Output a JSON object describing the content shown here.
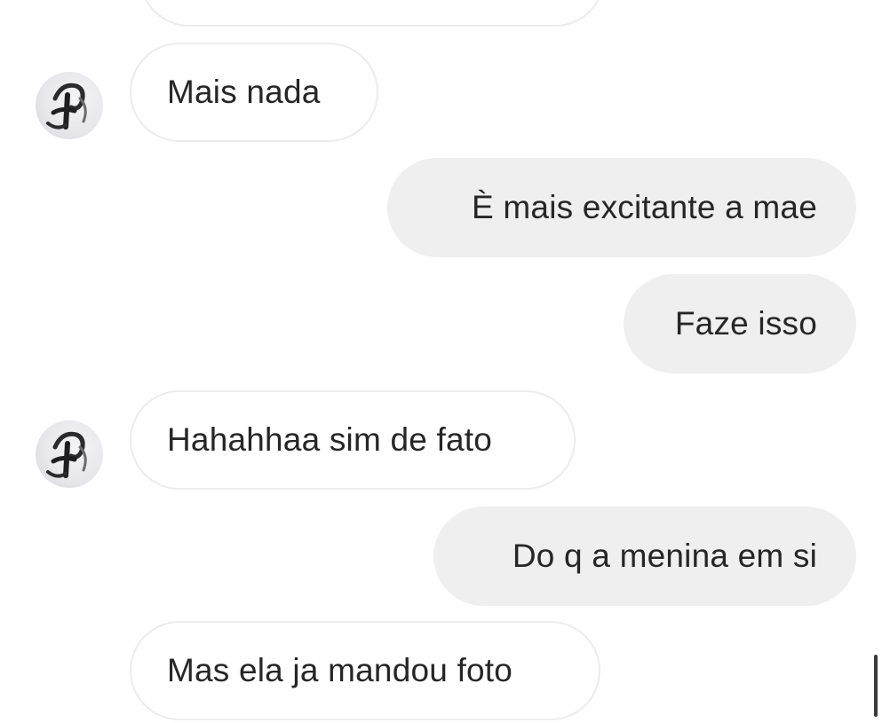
{
  "conversation": {
    "messages": [
      {
        "direction": "incoming",
        "text": ""
      },
      {
        "direction": "incoming",
        "text": "Mais nada"
      },
      {
        "direction": "outgoing",
        "text": "È mais excitante a mae"
      },
      {
        "direction": "outgoing",
        "text": "Faze isso"
      },
      {
        "direction": "incoming",
        "text": "Hahahhaa sim de fato"
      },
      {
        "direction": "outgoing",
        "text": "Do q a menina em si"
      },
      {
        "direction": "incoming",
        "text": "Mas ela ja mandou foto"
      }
    ]
  },
  "icons": {
    "avatar": "profile-avatar-icon"
  },
  "colors": {
    "incoming_bubble_bg": "#ffffff",
    "incoming_bubble_border": "#ececec",
    "outgoing_bubble_bg": "#efefef",
    "text": "#262626"
  }
}
